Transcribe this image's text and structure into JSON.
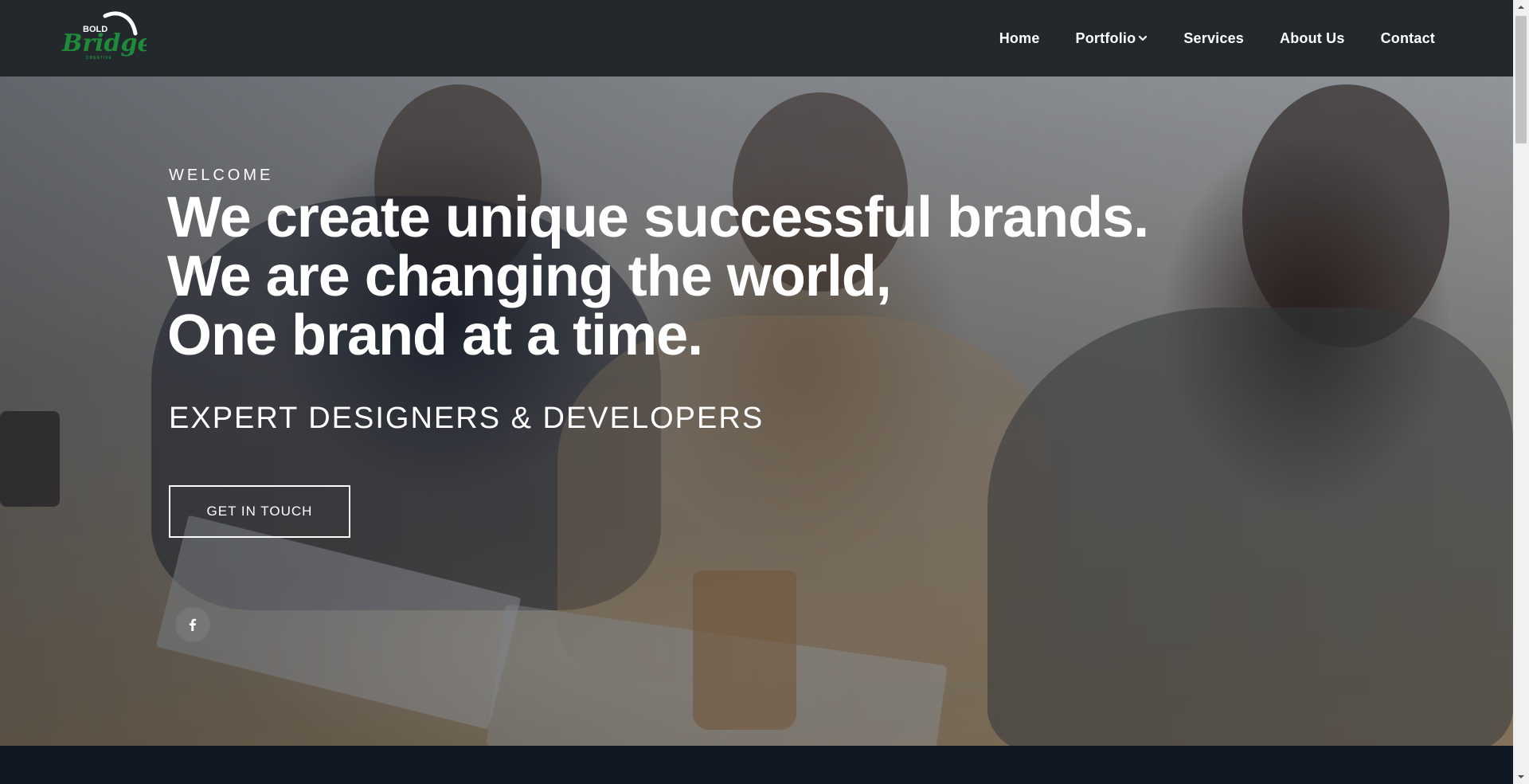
{
  "brand": {
    "logo_top": "BOLD",
    "logo_main": "Bridge",
    "logo_sub": "CREATIVE",
    "colors": {
      "green": "#1f8a3a",
      "header_bg": "#23282d"
    }
  },
  "nav": {
    "items": [
      {
        "label": "Home"
      },
      {
        "label": "Portfolio",
        "has_dropdown": true,
        "icon": "chevron-down-icon"
      },
      {
        "label": "Services"
      },
      {
        "label": "About Us"
      },
      {
        "label": "Contact"
      }
    ]
  },
  "hero": {
    "eyebrow": "WELCOME",
    "headline": [
      "We create unique successful brands.",
      "We are changing the world,",
      "One brand at a time."
    ],
    "subhead": "EXPERT DESIGNERS & DEVELOPERS",
    "cta_label": "GET IN TOUCH",
    "social": [
      {
        "icon": "facebook-icon"
      }
    ]
  }
}
